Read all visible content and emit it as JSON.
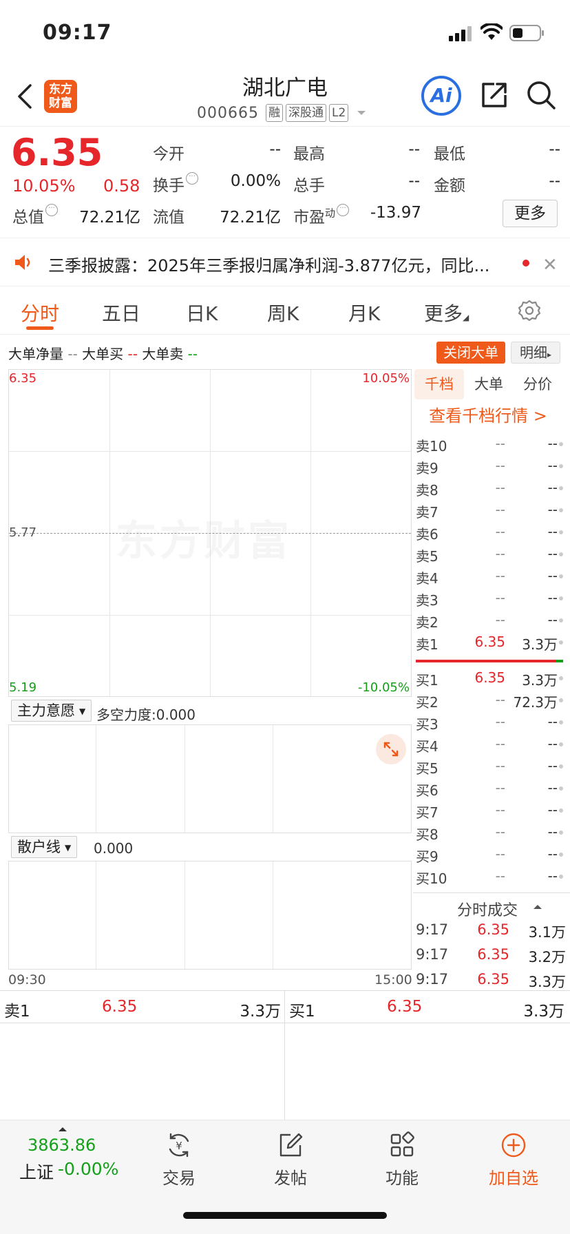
{
  "status_bar": {
    "time": "09:17"
  },
  "header": {
    "logo_text_1": "东方",
    "logo_text_2": "财富",
    "stock_name": "湖北广电",
    "stock_code": "000665",
    "tags": [
      "融",
      "深股通",
      "L2"
    ],
    "ai_label": "Ai"
  },
  "quote": {
    "last_price": "6.35",
    "change_pct": "10.05%",
    "change_amt": "0.58",
    "open_label": "今开",
    "open_value": "--",
    "high_label": "最高",
    "high_value": "--",
    "low_label": "最低",
    "low_value": "--",
    "turnover_label": "换手",
    "turnover_value": "0.00%",
    "volume_label": "总手",
    "volume_value": "--",
    "amount_label": "金额",
    "amount_value": "--",
    "mcap_label": "总值",
    "mcap_value": "72.21亿",
    "float_label": "流值",
    "float_value": "72.21亿",
    "pe_label": "市盈",
    "pe_sup": "动",
    "pe_value": "-13.97",
    "more_label": "更多"
  },
  "notice": {
    "text": "三季报披露：2025年三季报归属净利润-3.877亿元，同比..."
  },
  "tabs": {
    "items": [
      "分时",
      "五日",
      "日K",
      "周K",
      "月K",
      "更多"
    ],
    "active": "分时"
  },
  "bigorder": {
    "net_label": "大单净量",
    "net_value": "--",
    "buy_label": "大单买",
    "buy_value": "--",
    "sell_label": "大单卖",
    "sell_value": "--",
    "close_label": "关闭大单",
    "detail_label": "明细"
  },
  "chart": {
    "watermark": "东方财富",
    "price_top": "6.35",
    "pct_top": "10.05%",
    "price_mid": "5.77",
    "price_bottom": "5.19",
    "pct_bottom": "-10.05%",
    "time_start": "09:30",
    "time_end": "15:00"
  },
  "sub1": {
    "select_label": "主力意愿",
    "indicator": "多空力度:0.000"
  },
  "sub2": {
    "select_label": "散户线",
    "indicator": "0.000"
  },
  "order_book": {
    "tabs": [
      "千档",
      "大单",
      "分价"
    ],
    "depth_link": "查看千档行情 >",
    "asks": [
      {
        "label": "卖10",
        "price": "--",
        "volume": "--"
      },
      {
        "label": "卖9",
        "price": "--",
        "volume": "--"
      },
      {
        "label": "卖8",
        "price": "--",
        "volume": "--"
      },
      {
        "label": "卖7",
        "price": "--",
        "volume": "--"
      },
      {
        "label": "卖6",
        "price": "--",
        "volume": "--"
      },
      {
        "label": "卖5",
        "price": "--",
        "volume": "--"
      },
      {
        "label": "卖4",
        "price": "--",
        "volume": "--"
      },
      {
        "label": "卖3",
        "price": "--",
        "volume": "--"
      },
      {
        "label": "卖2",
        "price": "--",
        "volume": "--"
      },
      {
        "label": "卖1",
        "price": "6.35",
        "volume": "3.3万"
      }
    ],
    "bids": [
      {
        "label": "买1",
        "price": "6.35",
        "volume": "3.3万"
      },
      {
        "label": "买2",
        "price": "--",
        "volume": "72.3万"
      },
      {
        "label": "买3",
        "price": "--",
        "volume": "--"
      },
      {
        "label": "买4",
        "price": "--",
        "volume": "--"
      },
      {
        "label": "买5",
        "price": "--",
        "volume": "--"
      },
      {
        "label": "买6",
        "price": "--",
        "volume": "--"
      },
      {
        "label": "买7",
        "price": "--",
        "volume": "--"
      },
      {
        "label": "买8",
        "price": "--",
        "volume": "--"
      },
      {
        "label": "买9",
        "price": "--",
        "volume": "--"
      },
      {
        "label": "买10",
        "price": "--",
        "volume": "--"
      }
    ]
  },
  "ticks": {
    "title": "分时成交",
    "rows": [
      {
        "time": "9:17",
        "price": "6.35",
        "volume": "3.1万"
      },
      {
        "time": "9:17",
        "price": "6.35",
        "volume": "3.2万"
      },
      {
        "time": "9:17",
        "price": "6.35",
        "volume": "3.3万"
      }
    ]
  },
  "level1": {
    "ask_label": "卖1",
    "ask_price": "6.35",
    "ask_volume": "3.3万",
    "bid_label": "买1",
    "bid_price": "6.35",
    "bid_volume": "3.3万"
  },
  "bottom_bar": {
    "index_value": "3863.86",
    "index_name": "上证",
    "index_change": "-0.00%",
    "tools": [
      "交易",
      "发帖",
      "功能",
      "加自选"
    ]
  },
  "colors": {
    "up": "#e5262a",
    "down": "#14a019",
    "accent": "#ef5a1a",
    "ai": "#2a6fe0"
  }
}
